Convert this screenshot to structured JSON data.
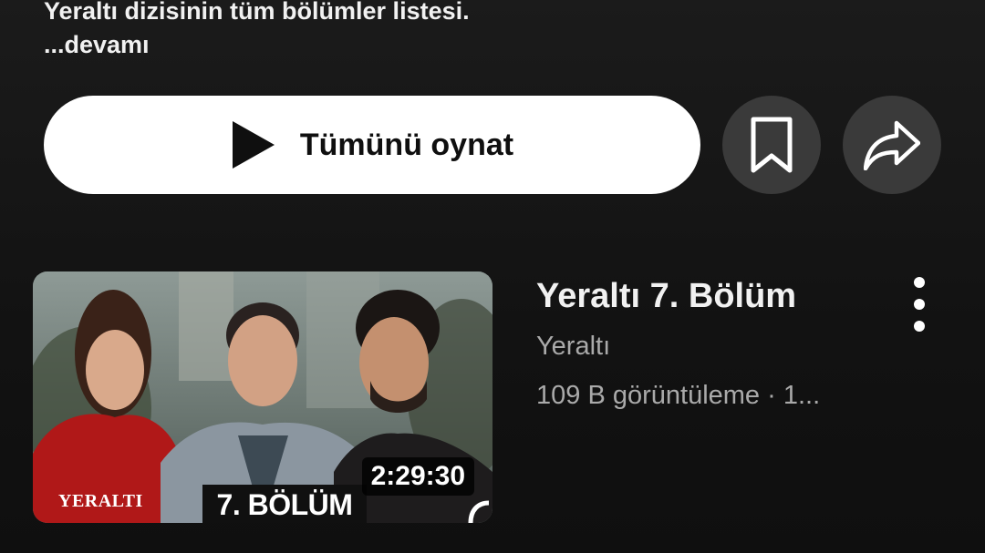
{
  "description": {
    "text": "Yeraltı dizisinin tüm bölümler listesi.",
    "more_label": "...devamı"
  },
  "actions": {
    "play_all_label": "Tümünü oynat",
    "save_icon": "bookmark-icon",
    "share_icon": "share-icon"
  },
  "video": {
    "title": "Yeraltı 7. Bölüm",
    "channel": "Yeraltı",
    "stats": "109 B görüntüleme · 1...",
    "duration": "2:29:30",
    "thumbnail_text": {
      "brand": "YERALTI",
      "episode": "7. BÖLÜM"
    }
  },
  "colors": {
    "background": "#0f0f0f",
    "primary_button": "#ffffff",
    "round_button": "#3a3a3a",
    "secondary_text": "#aaaaaa"
  }
}
